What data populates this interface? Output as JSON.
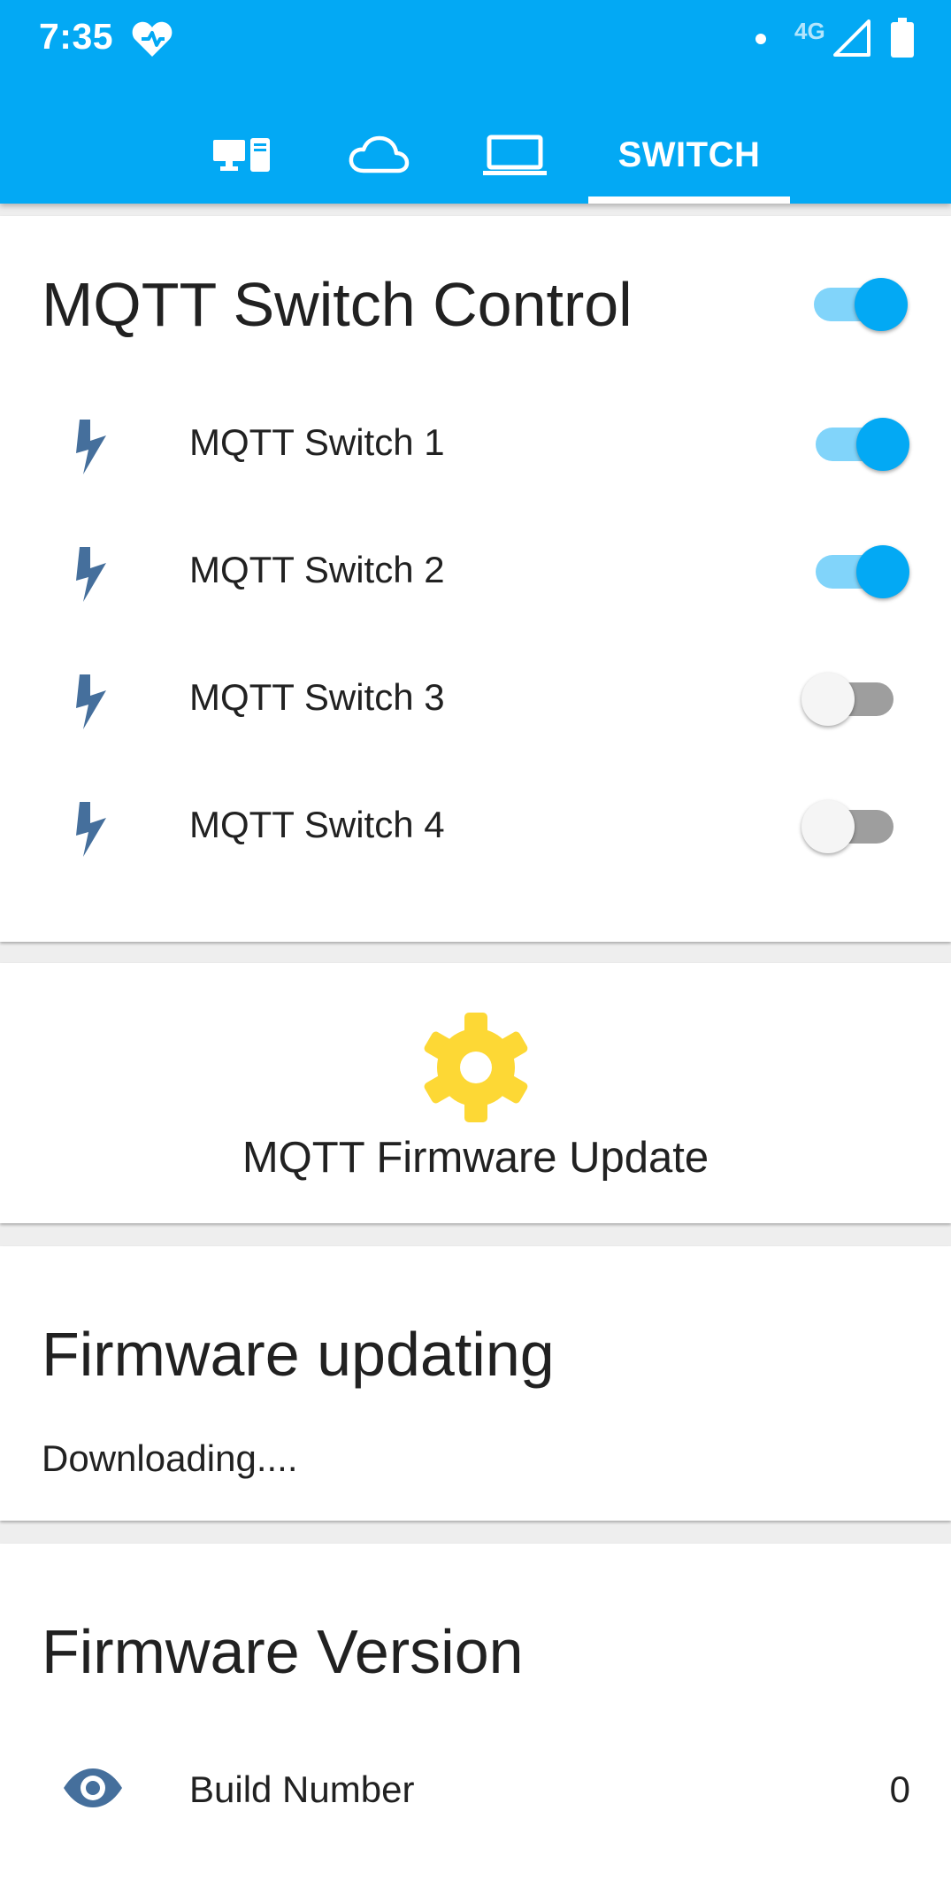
{
  "status_bar": {
    "time": "7:35",
    "network": "4G",
    "icons": [
      "heart-check-icon",
      "notification-dot-icon",
      "signal-icon",
      "battery-icon"
    ]
  },
  "tabs": [
    {
      "icon": "devices-icon",
      "selected": false
    },
    {
      "icon": "cloud-icon",
      "selected": false
    },
    {
      "icon": "laptop-icon",
      "selected": false
    },
    {
      "label": "SWITCH",
      "selected": true
    }
  ],
  "switch_control": {
    "title": "MQTT Switch Control",
    "master_on": true,
    "switches": [
      {
        "label": "MQTT Switch 1",
        "on": true,
        "icon": "flash-icon"
      },
      {
        "label": "MQTT Switch 2",
        "on": true,
        "icon": "flash-icon"
      },
      {
        "label": "MQTT Switch 3",
        "on": false,
        "icon": "flash-icon"
      },
      {
        "label": "MQTT Switch 4",
        "on": false,
        "icon": "flash-icon"
      }
    ]
  },
  "firmware_update": {
    "label": "MQTT Firmware Update",
    "icon": "gear-icon"
  },
  "firmware_status": {
    "title": "Firmware updating",
    "message": "Downloading...."
  },
  "firmware_version": {
    "title": "Firmware Version",
    "rows": [
      {
        "label": "Build Number",
        "value": "0",
        "icon": "eye-icon"
      }
    ]
  },
  "colors": {
    "app_bar": "#03a9f4",
    "switch_on": "#03a9f4",
    "switch_on_track": "#81d4fa",
    "switch_off_track": "#9e9e9e",
    "bolt_icon": "#456f9c",
    "gear_icon": "#fdd835",
    "eye_icon": "#456f9c"
  }
}
